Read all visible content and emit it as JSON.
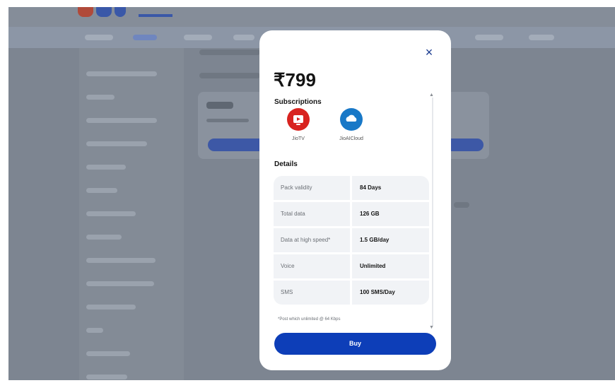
{
  "modal": {
    "close_label": "×",
    "price": "₹799",
    "subscriptions_title": "Subscriptions",
    "subscriptions": [
      {
        "name": "JioTV",
        "icon": "jiotv-icon",
        "color": "#d8231f"
      },
      {
        "name": "JioAICloud",
        "icon": "jioaicloud-icon",
        "color": "#1878c7"
      }
    ],
    "details_title": "Details",
    "details": [
      {
        "label": "Pack validity",
        "value": "84 Days"
      },
      {
        "label": "Total data",
        "value": "126 GB"
      },
      {
        "label": "Data at high speed*",
        "value": "1.5 GB/day"
      },
      {
        "label": "Voice",
        "value": "Unlimited"
      },
      {
        "label": "SMS",
        "value": "100 SMS/Day"
      }
    ],
    "footnote": "*Post which unlimited @ 64 Kbps",
    "buy_label": "Buy",
    "scroll_up": "▲",
    "scroll_down": "▼"
  },
  "colors": {
    "accent": "#0d3eb8",
    "overlay": "#7d8591"
  }
}
